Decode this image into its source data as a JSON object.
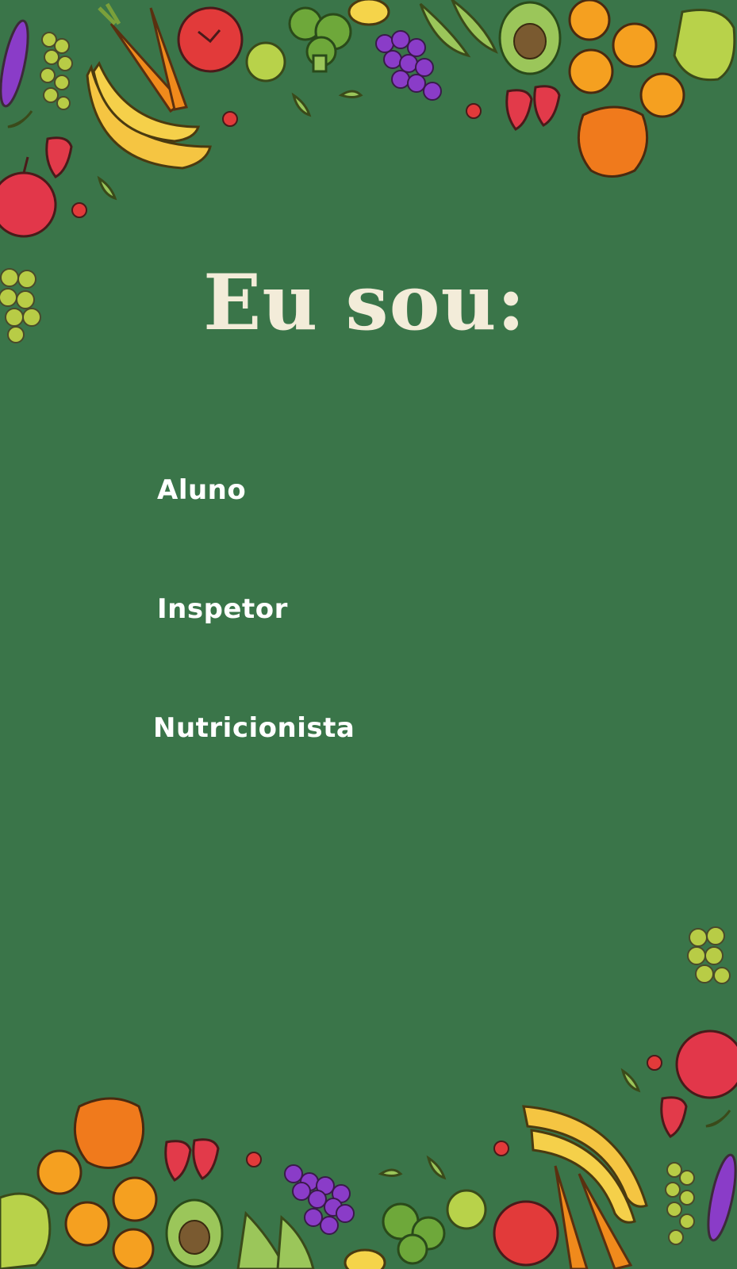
{
  "title": "Eu sou:",
  "roles": [
    {
      "label": "Aluno"
    },
    {
      "label": "Inspetor"
    },
    {
      "label": "Nutricionista"
    }
  ],
  "colors": {
    "background": "#3a7549",
    "title": "#f3ecd9",
    "role_text": "#ffffff"
  },
  "decorations": {
    "top_border": [
      "eggplant-icon",
      "grapes-icon",
      "carrot-icon",
      "tomato-icon",
      "banana-icon",
      "apple-icon",
      "broccoli-icon",
      "purple-grapes-icon",
      "lemon-icon",
      "leaves-icon",
      "avocado-icon",
      "orange-slice-icon",
      "strawberry-icon",
      "bell-pepper-icon"
    ],
    "bottom_border": [
      "grapes-icon",
      "apple-icon",
      "banana-icon",
      "carrot-icon",
      "tomato-icon",
      "broccoli-icon",
      "purple-grapes-icon",
      "avocado-icon",
      "orange-slice-icon",
      "strawberry-icon",
      "bell-pepper-icon",
      "eggplant-icon"
    ]
  }
}
